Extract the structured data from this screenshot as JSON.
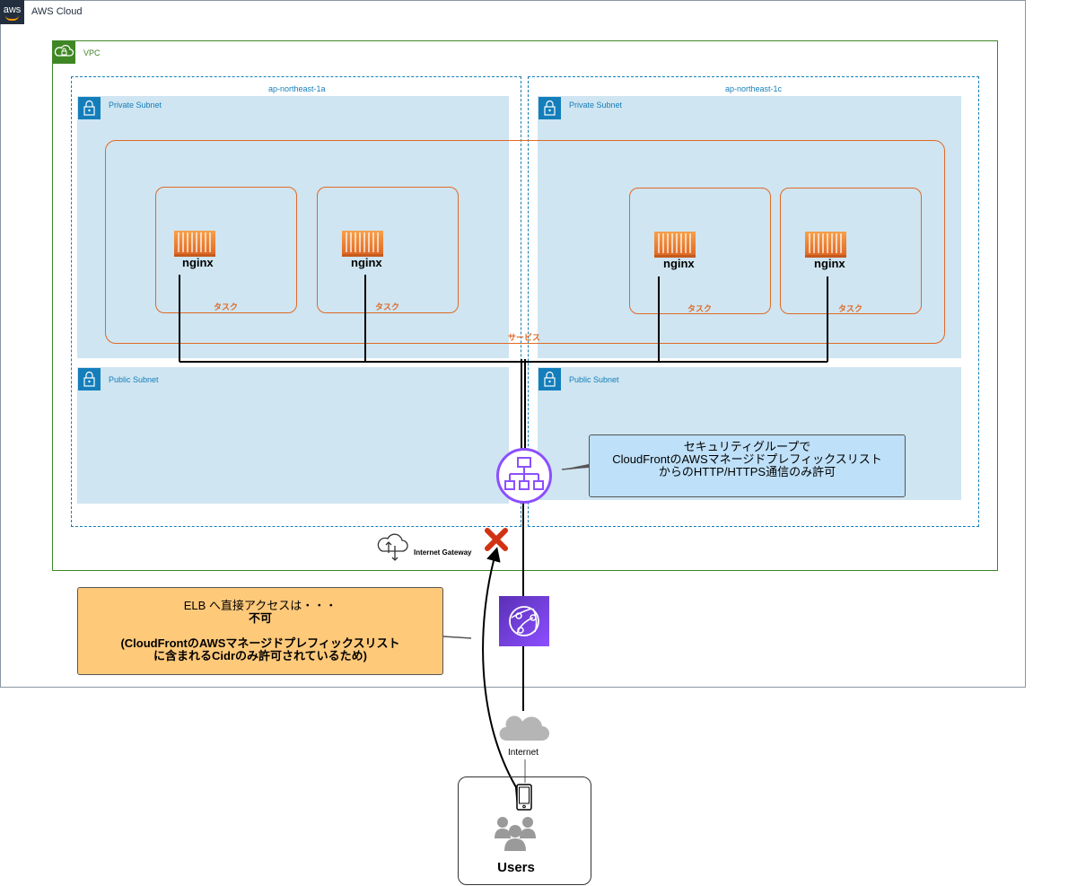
{
  "aws_cloud": {
    "logo_text": "aws",
    "title": "AWS Cloud"
  },
  "vpc": {
    "title": "VPC"
  },
  "availability_zones": [
    {
      "name": "ap-northeast-1a"
    },
    {
      "name": "ap-northeast-1c"
    }
  ],
  "subnets": {
    "private_label": "Private Subnet",
    "public_label": "Public Subnet"
  },
  "service": {
    "label": "サービス"
  },
  "tasks": [
    {
      "label": "タスク",
      "container": "nginx"
    },
    {
      "label": "タスク",
      "container": "nginx"
    },
    {
      "label": "タスク",
      "container": "nginx"
    },
    {
      "label": "タスク",
      "container": "nginx"
    }
  ],
  "security_group_note": {
    "line1": "セキュリティグループで",
    "line2": "CloudFrontのAWSマネージドプレフィックスリスト",
    "line3": "からのHTTP/HTTPS通信のみ許可"
  },
  "elb_note": {
    "line1": "ELB へ直接アクセスは・・・",
    "line2": "不可",
    "line3": "(CloudFrontのAWSマネージドプレフィックスリスト",
    "line4": "に含まれるCidrのみ許可されているため)"
  },
  "internet_gateway": {
    "label": "Internet Gateway"
  },
  "internet": {
    "label": "Internet"
  },
  "users": {
    "label": "Users"
  },
  "icons": [
    "aws-logo",
    "vpc-cloud-lock-icon",
    "subnet-lock-icon",
    "ecs-container-icon",
    "alb-icon",
    "cloudfront-icon",
    "internet-gateway-icon",
    "cloud-icon",
    "mobile-device-icon",
    "users-icon",
    "blocked-x-icon"
  ],
  "colors": {
    "vpc": "#3f8624",
    "subnet": "#147eba",
    "subnet_fill": "#cfe5f1",
    "ecs": "#e06a26",
    "alb": "#8c4fff",
    "note_blue": "#bee0f8",
    "note_orange": "#ffc97a",
    "block": "#d13212"
  }
}
